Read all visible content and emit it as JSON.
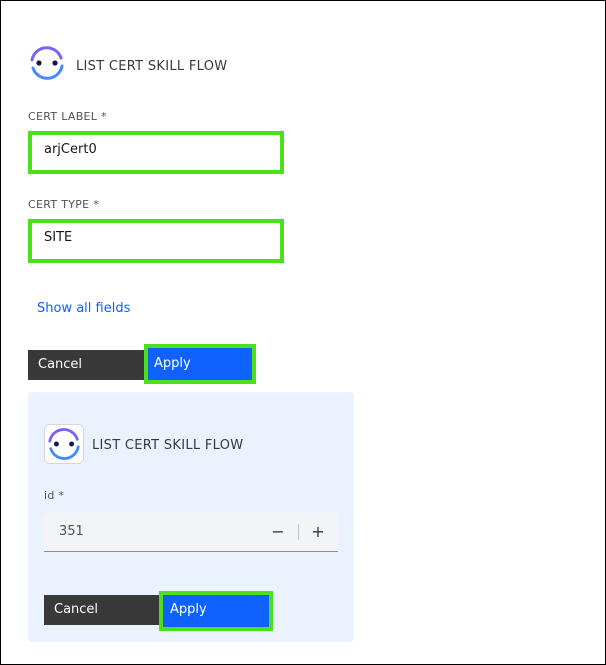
{
  "form": {
    "skill_title": "LIST CERT SKILL FLOW",
    "cert_label": {
      "label": "CERT LABEL *",
      "value": "arjCert0"
    },
    "cert_type": {
      "label": "CERT TYPE *",
      "value": "SITE"
    },
    "show_all_fields": "Show all fields",
    "cancel_label": "Cancel",
    "apply_label": "Apply"
  },
  "card": {
    "skill_title": "LIST CERT SKILL FLOW",
    "id_field": {
      "label": "id *",
      "value": "351",
      "decrement": "−",
      "increment": "+"
    },
    "cancel_label": "Cancel",
    "apply_label": "Apply"
  },
  "colors": {
    "highlight": "#4ce01c",
    "primary": "#0f62fe",
    "secondary_button": "#393939",
    "card_background": "#eaf2fd"
  }
}
